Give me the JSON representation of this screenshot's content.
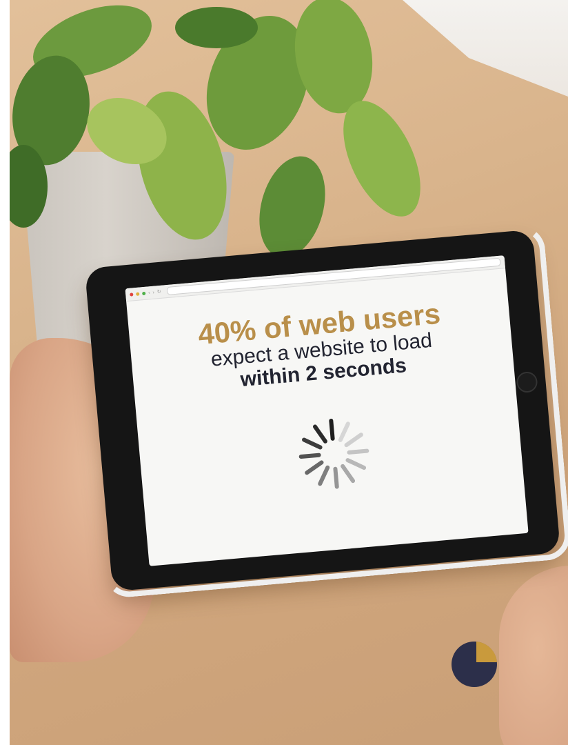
{
  "screen": {
    "headline_stat": "40% of web users",
    "headline_line2": "expect a website to load",
    "headline_line3": "within 2 seconds"
  },
  "browser": {
    "dot_colors": [
      "#e0443e",
      "#e0b23e",
      "#4fb04a"
    ]
  },
  "colors": {
    "accent_gold": "#b98f4a",
    "navy": "#2c2f4a",
    "spinner_dark": "#2b2b2b",
    "spinner_light": "#cfcfcf"
  },
  "icons": {
    "loader": "loading-spinner-icon",
    "brand": "pie-logo-icon"
  }
}
